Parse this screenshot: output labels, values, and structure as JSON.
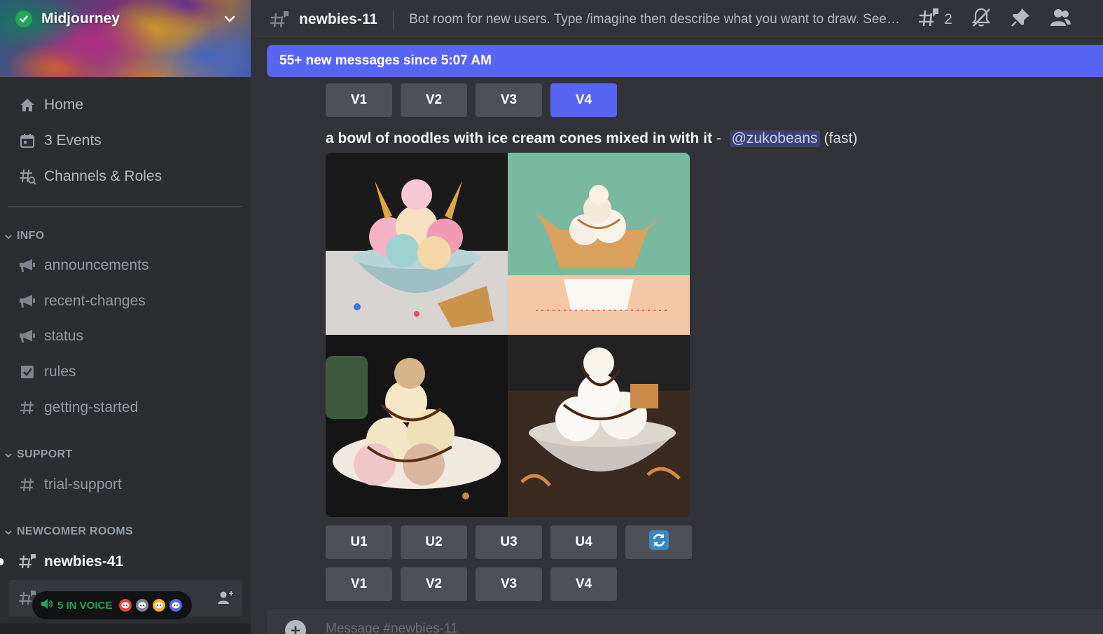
{
  "server": {
    "name": "Midjourney"
  },
  "nav": {
    "home": "Home",
    "events": "3 Events",
    "channels_roles": "Channels & Roles"
  },
  "categories": {
    "info": "INFO",
    "support": "SUPPORT",
    "newcomer": "NEWCOMER ROOMS"
  },
  "channels": {
    "announcements": "announcements",
    "recent_changes": "recent-changes",
    "status": "status",
    "rules": "rules",
    "getting_started": "getting-started",
    "trial_support": "trial-support",
    "newbies_41": "newbies-41"
  },
  "voice": {
    "label": "5 IN VOICE",
    "avatar_colors": [
      "#f23f43",
      "#80848e",
      "#f0b232",
      "#5865f2"
    ]
  },
  "topbar": {
    "channel": "newbies-11",
    "topic": "Bot room for new users. Type /imagine then describe what you want to draw. See https://docs.midjourney.com/ for more information",
    "threads_count": "2"
  },
  "banner": {
    "text": "55+ new messages since 5:07 AM"
  },
  "top_buttons": [
    "V1",
    "V2",
    "V3",
    "V4"
  ],
  "selected_top_button": "V4",
  "message": {
    "prompt": "a bowl of noodles with ice cream cones mixed in with it",
    "separator": " - ",
    "mention": "@zukobeans",
    "mode": "(fast)"
  },
  "upscale_buttons": [
    "U1",
    "U2",
    "U3",
    "U4"
  ],
  "variation_buttons": [
    "V1",
    "V2",
    "V3",
    "V4"
  ],
  "composer": {
    "placeholder": "Message #newbies-11"
  },
  "colors": {
    "accent": "#5865f2",
    "sidebar": "#2b2d31",
    "chat": "#313338",
    "button": "#4e5058"
  }
}
